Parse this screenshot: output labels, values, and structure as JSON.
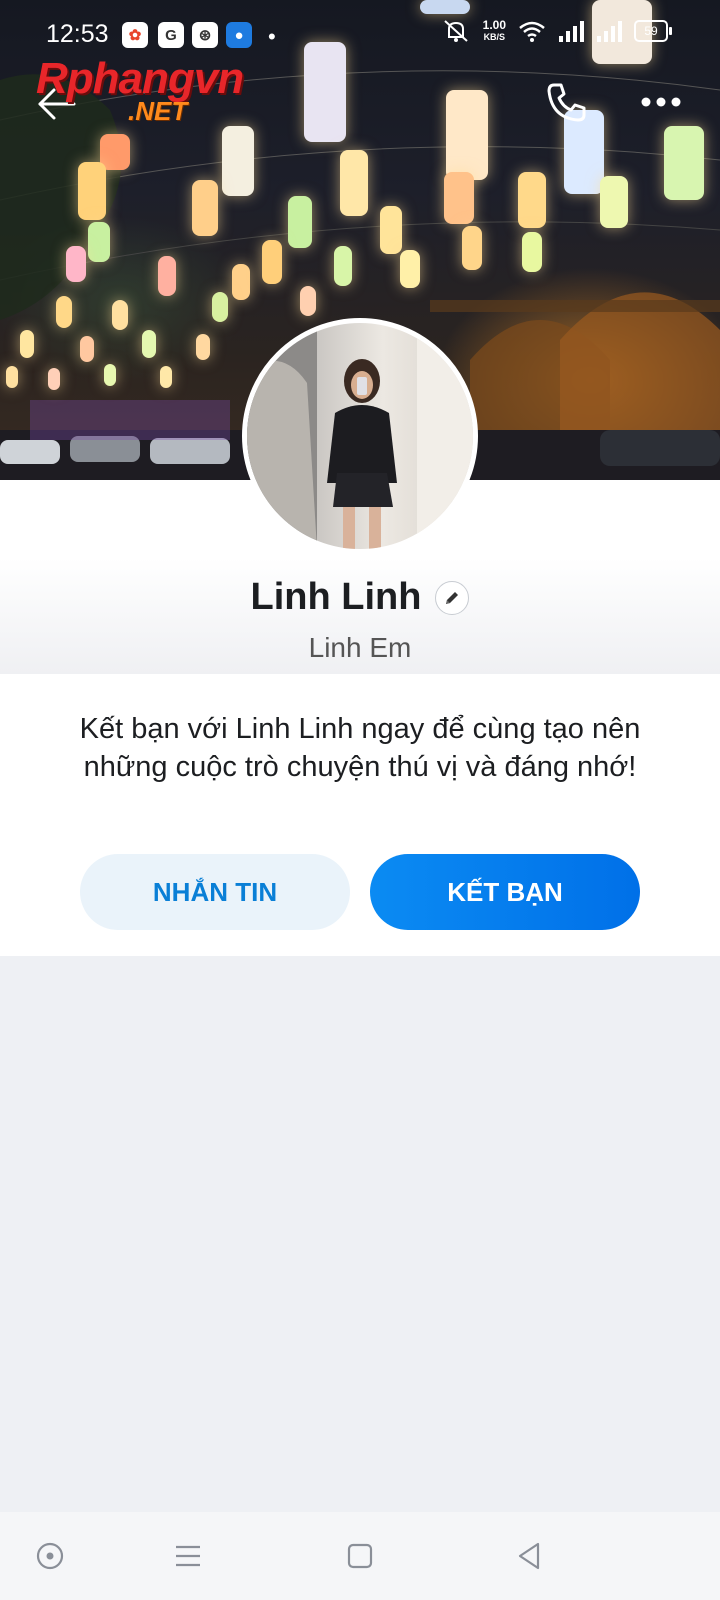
{
  "status_bar": {
    "time": "12:53",
    "app_icons": [
      "photos-icon",
      "google-icon",
      "compass-icon",
      "vpn-icon"
    ],
    "network_speed": "1.00",
    "network_speed_unit": "KB/S",
    "battery": "59"
  },
  "header": {
    "watermark_main": "Rphangvn",
    "watermark_sub": ".NET"
  },
  "profile": {
    "name": "Linh Linh",
    "alias": "Linh Em"
  },
  "invite": {
    "message": "Kết bạn với Linh Linh ngay để cùng tạo nên những cuộc trò chuyện thú vị và đáng nhớ!",
    "message_button": "NHẮN TIN",
    "add_friend_button": "KẾT BẠN"
  },
  "colors": {
    "accent": "#0a84f0",
    "secondary_button_bg": "#eaf3fa",
    "page_bg": "#eef0f4"
  }
}
